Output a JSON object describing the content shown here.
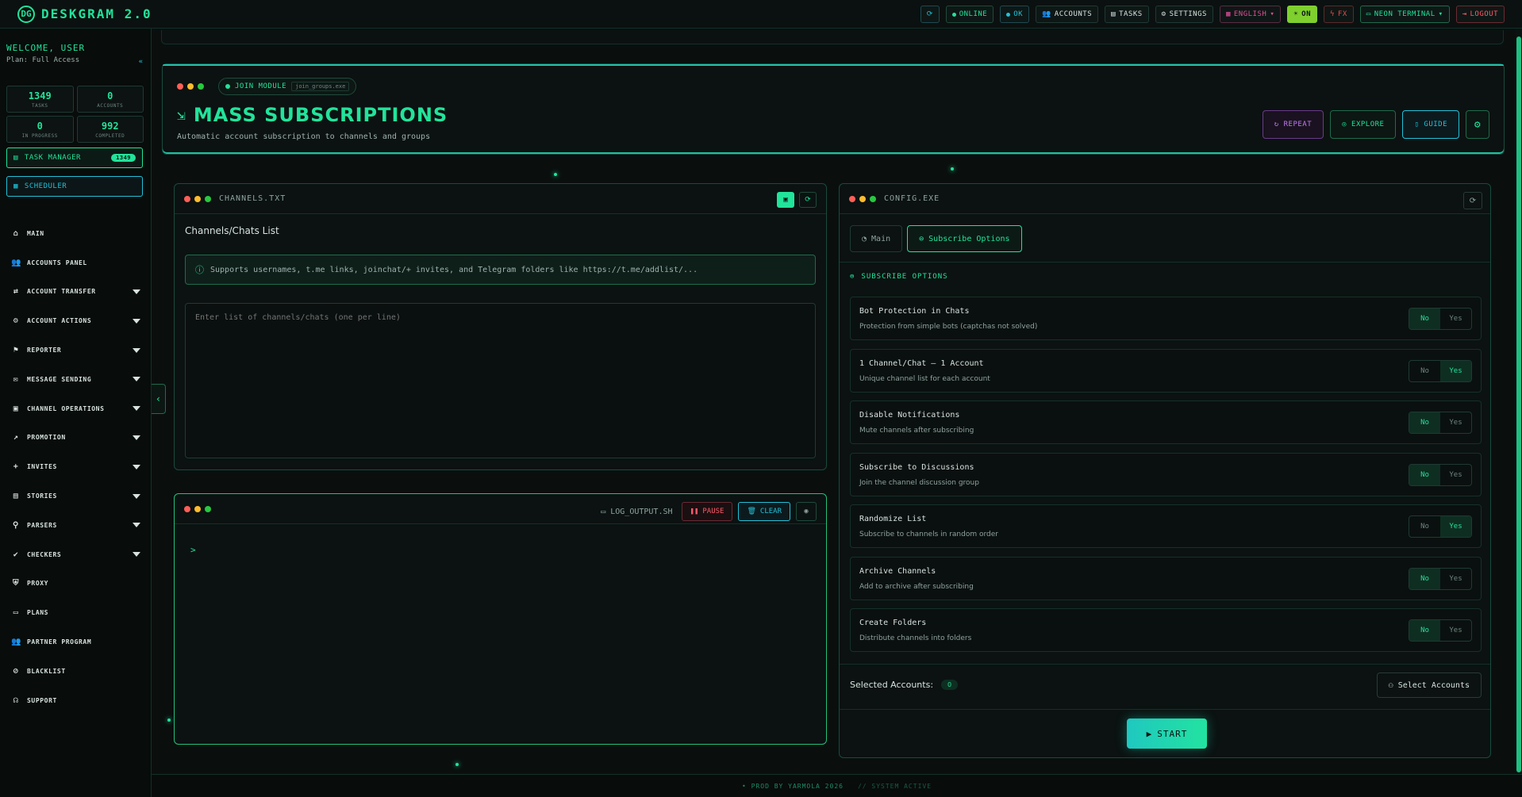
{
  "topbar": {
    "brand": "DESKGRAM 2.0",
    "brand_logo": "DG",
    "online": "ONLINE",
    "ok": "OK",
    "accounts": "ACCOUNTS",
    "tasks": "TASKS",
    "settings": "SETTINGS",
    "language": "ENGLISH",
    "sun": "ON",
    "fx": "FX",
    "theme": "NEON TERMINAL",
    "logout": "LOGOUT"
  },
  "sidebar": {
    "welcome": "WELCOME, USER",
    "plan": "Plan: Full Access",
    "stats": [
      {
        "value": "1349",
        "label": "TASKS"
      },
      {
        "value": "0",
        "label": "ACCOUNTS"
      },
      {
        "value": "0",
        "label": "IN PROGRESS"
      },
      {
        "value": "992",
        "label": "COMPLETED"
      }
    ],
    "task_manager": "TASK MANAGER",
    "task_manager_badge": "1349",
    "scheduler": "SCHEDULER",
    "nav": [
      {
        "label": "MAIN",
        "icon": "home-icon",
        "glyph": "⌂",
        "chevron": false
      },
      {
        "label": "ACCOUNTS PANEL",
        "icon": "users-icon",
        "glyph": "👥",
        "chevron": false
      },
      {
        "label": "ACCOUNT TRANSFER",
        "icon": "user-transfer-icon",
        "glyph": "⇄",
        "chevron": true
      },
      {
        "label": "ACCOUNT ACTIONS",
        "icon": "user-cog-icon",
        "glyph": "⚙",
        "chevron": true
      },
      {
        "label": "REPORTER",
        "icon": "flag-icon",
        "glyph": "⚑",
        "chevron": true
      },
      {
        "label": "MESSAGE SENDING",
        "icon": "chat-icon",
        "glyph": "✉",
        "chevron": true
      },
      {
        "label": "CHANNEL OPERATIONS",
        "icon": "briefcase-icon",
        "glyph": "▣",
        "chevron": true
      },
      {
        "label": "PROMOTION",
        "icon": "chart-icon",
        "glyph": "↗",
        "chevron": true
      },
      {
        "label": "INVITES",
        "icon": "user-plus-icon",
        "glyph": "+",
        "chevron": true
      },
      {
        "label": "STORIES",
        "icon": "stories-icon",
        "glyph": "▤",
        "chevron": true
      },
      {
        "label": "PARSERS",
        "icon": "search-icon",
        "glyph": "⚲",
        "chevron": true
      },
      {
        "label": "CHECKERS",
        "icon": "check-circle-icon",
        "glyph": "✔",
        "chevron": true
      },
      {
        "label": "PROXY",
        "icon": "shield-icon",
        "glyph": "⛨",
        "chevron": false
      },
      {
        "label": "PLANS",
        "icon": "wallet-icon",
        "glyph": "▭",
        "chevron": false
      },
      {
        "label": "PARTNER PROGRAM",
        "icon": "partner-icon",
        "glyph": "👥",
        "chevron": false
      },
      {
        "label": "BLACKLIST",
        "icon": "user-block-icon",
        "glyph": "⊘",
        "chevron": false
      },
      {
        "label": "SUPPORT",
        "icon": "headset-icon",
        "glyph": "☊",
        "chevron": false
      }
    ]
  },
  "header": {
    "module": "JOIN MODULE",
    "file": "join_groups.exe",
    "title": "MASS SUBSCRIPTIONS",
    "subtitle": "Automatic account subscription to channels and groups",
    "repeat": "REPEAT",
    "explore": "EXPLORE",
    "guide": "GUIDE"
  },
  "channels": {
    "file": "CHANNELS.TXT",
    "label": "Channels/Chats List",
    "info": "Supports usernames, t.me links, joinchat/+ invites, and Telegram folders like https://t.me/addlist/...",
    "placeholder": "Enter list of channels/chats (one per line)"
  },
  "log": {
    "file": "LOG_OUTPUT.SH",
    "pause": "PAUSE",
    "clear": "CLEAR",
    "prompt": ">"
  },
  "config": {
    "file": "CONFIG.EXE",
    "tab_main": "Main",
    "tab_subscribe": "Subscribe Options",
    "section": "SUBSCRIBE OPTIONS",
    "no": "No",
    "yes": "Yes",
    "options": [
      {
        "name": "Bot Protection in Chats",
        "desc": "Protection from simple bots (captchas not solved)",
        "value": "No"
      },
      {
        "name": "1 Channel/Chat — 1 Account",
        "desc": "Unique channel list for each account",
        "value": "Yes"
      },
      {
        "name": "Disable Notifications",
        "desc": "Mute channels after subscribing",
        "value": "No"
      },
      {
        "name": "Subscribe to Discussions",
        "desc": "Join the channel discussion group",
        "value": "No"
      },
      {
        "name": "Randomize List",
        "desc": "Subscribe to channels in random order",
        "value": "Yes"
      },
      {
        "name": "Archive Channels",
        "desc": "Add to archive after subscribing",
        "value": "No"
      },
      {
        "name": "Create Folders",
        "desc": "Distribute channels into folders",
        "value": "No"
      }
    ],
    "selected_label": "Selected Accounts:",
    "selected_count": "0",
    "select_button": "Select Accounts",
    "start": "START"
  },
  "footer": {
    "credit": "• PROD BY YARMOLA 2026",
    "status": "// SYSTEM ACTIVE"
  },
  "colors": {
    "accent": "#22e39a",
    "cyan": "#22c1d8",
    "background": "#0a0f0e"
  }
}
